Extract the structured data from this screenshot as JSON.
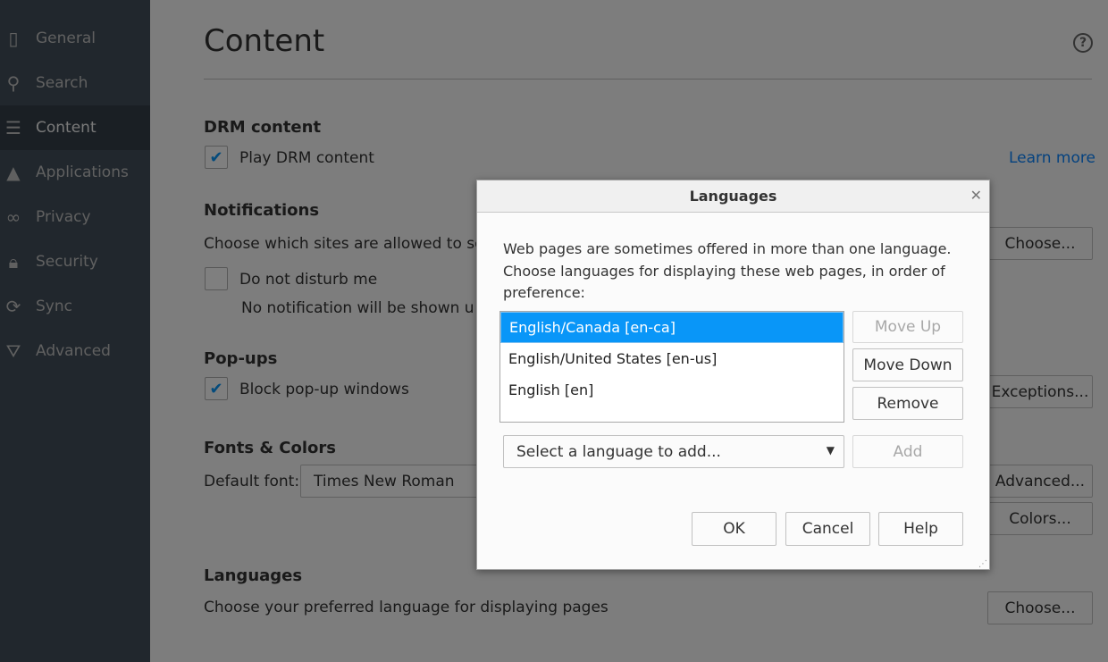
{
  "sidebar": {
    "items": [
      {
        "label": "General",
        "icon": "general-icon"
      },
      {
        "label": "Search",
        "icon": "search-icon"
      },
      {
        "label": "Content",
        "icon": "content-icon",
        "selected": true
      },
      {
        "label": "Applications",
        "icon": "rocket-icon"
      },
      {
        "label": "Privacy",
        "icon": "mask-icon"
      },
      {
        "label": "Security",
        "icon": "lock-icon"
      },
      {
        "label": "Sync",
        "icon": "sync-icon"
      },
      {
        "label": "Advanced",
        "icon": "wizard-hat-icon"
      }
    ]
  },
  "main": {
    "title": "Content",
    "drm": {
      "heading": "DRM content",
      "checkbox": "Play DRM content",
      "checked": true,
      "learn_more": "Learn more"
    },
    "notifications": {
      "heading": "Notifications",
      "desc": "Choose which sites are allowed to se",
      "choose": "Choose...",
      "dnd": "Do not disturb me",
      "dnd_desc": "No notification will be shown u"
    },
    "popups": {
      "heading": "Pop-ups",
      "checkbox": "Block pop-up windows",
      "checked": true,
      "exceptions": "Exceptions..."
    },
    "fonts": {
      "heading": "Fonts & Colors",
      "default_font_label": "Default font:",
      "default_font": "Times New Roman",
      "advanced": "Advanced...",
      "colors": "Colors..."
    },
    "languages": {
      "heading": "Languages",
      "desc": "Choose your preferred language for displaying pages",
      "choose": "Choose..."
    }
  },
  "dialog": {
    "title": "Languages",
    "description": "Web pages are sometimes offered in more than one language. Choose languages for displaying these web pages, in order of preference:",
    "languages": [
      "English/Canada  [en-ca]",
      "English/United States  [en-us]",
      "English  [en]"
    ],
    "move_up": "Move Up",
    "move_down": "Move Down",
    "remove": "Remove",
    "select_placeholder": "Select a language to add...",
    "add": "Add",
    "ok": "OK",
    "cancel": "Cancel",
    "help": "Help"
  }
}
